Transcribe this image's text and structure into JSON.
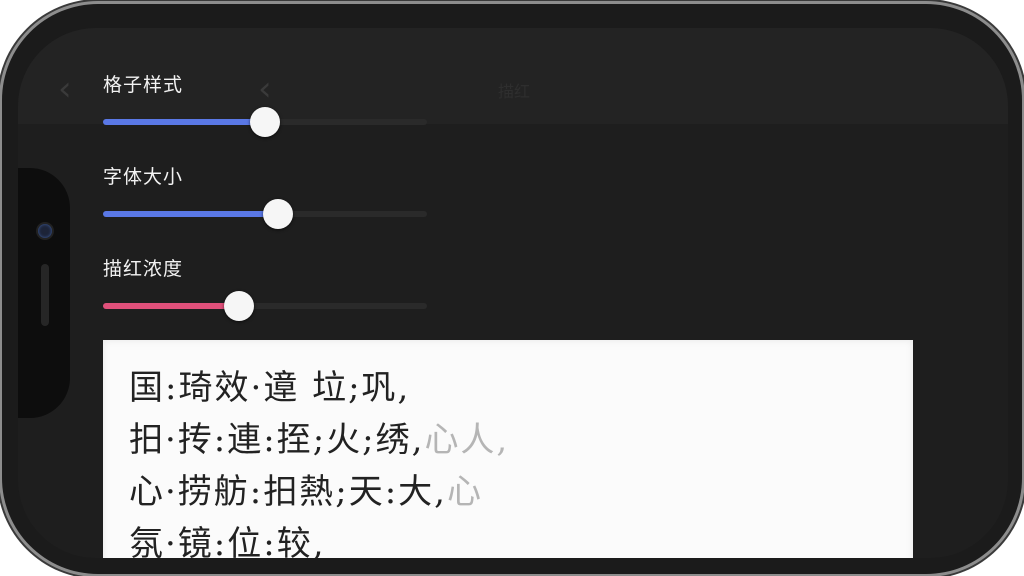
{
  "nav": {
    "back_glyph": "‹",
    "back_glyph_2": "‹",
    "title": "描红"
  },
  "settings": [
    {
      "label": "格子样式",
      "value": 0.5,
      "fill_color": "#5a78e6"
    },
    {
      "label": "字体大小",
      "value": 0.54,
      "fill_color": "#5a78e6"
    },
    {
      "label": "描红浓度",
      "value": 0.42,
      "fill_color": "#e0507a"
    }
  ],
  "paper": {
    "lines": [
      {
        "text": "国:琦效·遧 垃;巩,",
        "faint": ""
      },
      {
        "text": "抇·抟:連:挃;火;绣,",
        "faint": "心人,"
      },
      {
        "text": "心·捞舫:抇熱;天:大,",
        "faint": "心"
      },
      {
        "text": "氛·镜:位:较,",
        "faint": ""
      }
    ]
  }
}
